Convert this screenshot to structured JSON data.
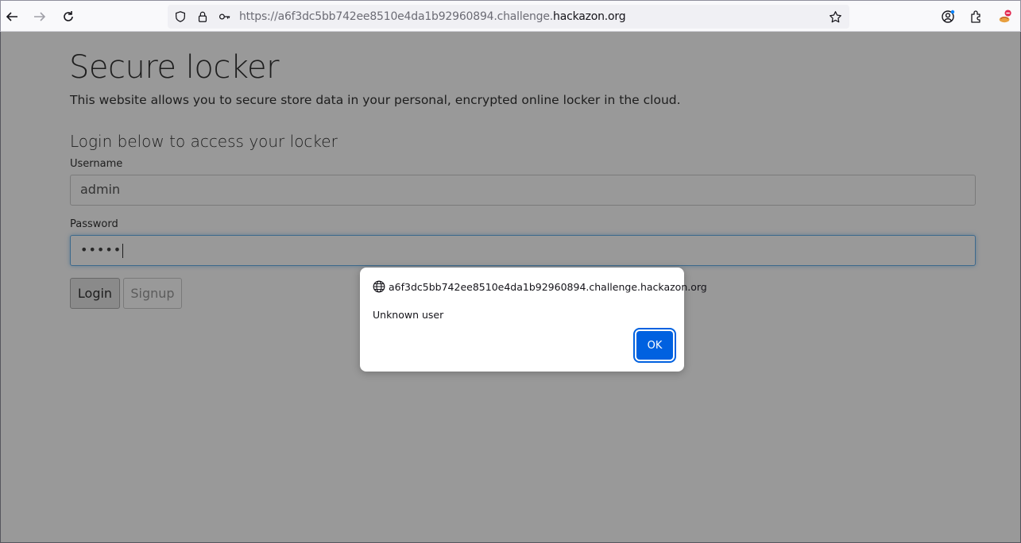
{
  "browser": {
    "url_prefix": "https://a6f3dc5bb742ee8510e4da1b92960894.challenge.",
    "url_domain": "hackazon.org",
    "icons": [
      "back-arrow-icon",
      "forward-arrow-icon",
      "reload-icon",
      "shield-icon",
      "lock-icon",
      "key-icon",
      "bookmark-star-icon",
      "account-icon",
      "extensions-icon",
      "extension-badge-icon"
    ]
  },
  "page": {
    "title": "Secure locker",
    "subtitle": "This website allows you to secure store data in your personal, encrypted online locker in the cloud.",
    "section_title": "Login below to access your locker",
    "username_label": "Username",
    "username_value": "admin",
    "password_label": "Password",
    "password_value": "•••••",
    "login_label": "Login",
    "signup_label": "Signup"
  },
  "dialog": {
    "origin": "a6f3dc5bb742ee8510e4da1b92960894.challenge.hackazon.org",
    "message": "Unknown user",
    "ok_label": "OK"
  },
  "colors": {
    "accent": "#0061e0",
    "focus": "#66afe9"
  }
}
